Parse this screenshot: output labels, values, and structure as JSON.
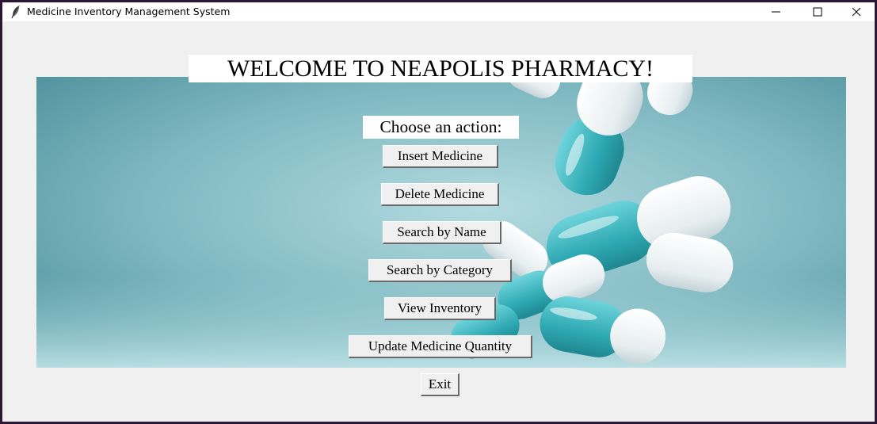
{
  "window": {
    "title": "Medicine Inventory Management System",
    "icon": "feather-icon",
    "controls": [
      "minimize-icon",
      "maximize-icon",
      "close-icon"
    ]
  },
  "main": {
    "welcome": "WELCOME TO NEAPOLIS PHARMACY!",
    "prompt": "Choose an action:",
    "background_image": "medicine capsules",
    "buttons": {
      "insert": "Insert Medicine",
      "delete": "Delete Medicine",
      "search_name": "Search by Name",
      "search_category": "Search by Category",
      "view": "View Inventory",
      "update": "Update Medicine Quantity",
      "exit": "Exit"
    }
  },
  "colors": {
    "background_teal": "#6aa9b2",
    "capsule_teal": "#3fb7c0",
    "window_bg": "#f0f0f0"
  }
}
